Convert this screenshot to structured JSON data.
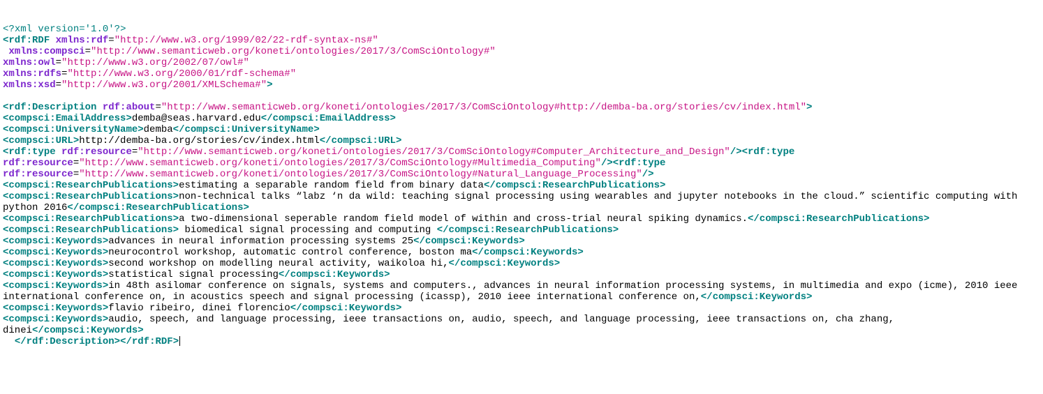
{
  "xml_decl": "<?xml version='1.0'?>",
  "ns": {
    "rdf": "http://www.w3.org/1999/02/22-rdf-syntax-ns#",
    "compsci": "http://www.semanticweb.org/koneti/ontologies/2017/3/ComSciOntology#",
    "owl": "http://www.w3.org/2002/07/owl#",
    "rdfs": "http://www.w3.org/2000/01/rdf-schema#",
    "xsd": "http://www.w3.org/2001/XMLSchema#"
  },
  "about": "http://www.semanticweb.org/koneti/ontologies/2017/3/ComSciOntology#http://demba-ba.org/stories/cv/index.html",
  "email": "demba@seas.harvard.edu",
  "university": "demba",
  "url": "http://demba-ba.org/stories/cv/index.html",
  "types": [
    "http://www.semanticweb.org/koneti/ontologies/2017/3/ComSciOntology#Computer_Architecture_and_Design",
    "http://www.semanticweb.org/koneti/ontologies/2017/3/ComSciOntology#Multimedia_Computing",
    "http://www.semanticweb.org/koneti/ontologies/2017/3/ComSciOntology#Natural_Language_Processing"
  ],
  "pubs": [
    "estimating a separable random field from binary data",
    "non-technical talks “labz ‘n da wild: teaching signal processing using wearables and jupyter notebooks in the cloud.” scientific computing with python 2016",
    "a two-dimensional seperable random field model of within and cross-trial neural spiking dynamics.",
    " biomedical signal processing and computing "
  ],
  "keywords": [
    "advances in neural information processing systems 25",
    "neurocontrol workshop, automatic control conference, boston ma",
    "second workshop on modelling neural activity, waikoloa hi,",
    "statistical signal processing",
    "in 48th asilomar conference on signals, systems and computers., advances in neural information processing systems, in multimedia and expo (icme), 2010 ieee international conference on, in acoustics speech and signal processing (icassp), 2010 ieee international conference on,",
    "flavio ribeiro, dinei florencio",
    "audio, speech, and language processing, ieee transactions on, audio, speech, and language processing, ieee transactions on, cha zhang, dinei"
  ]
}
